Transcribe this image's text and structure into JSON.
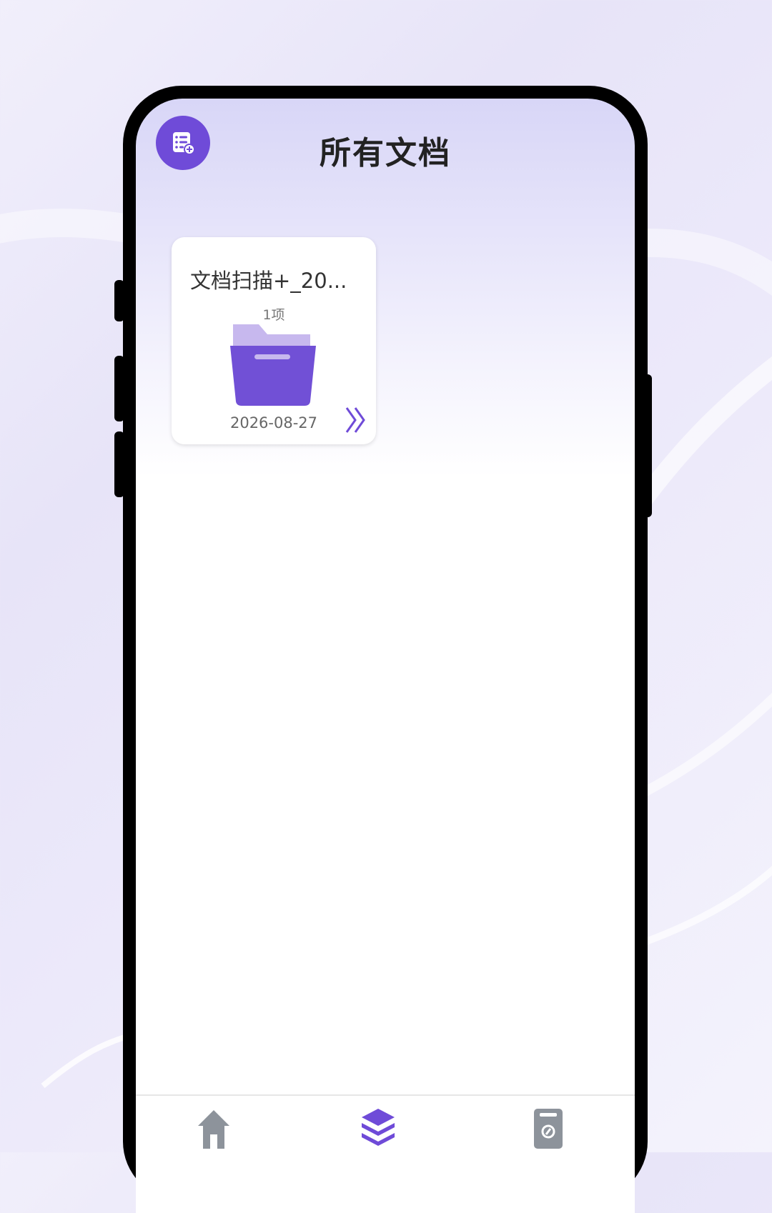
{
  "header": {
    "title": "所有文档",
    "add_icon": "document-list-add-icon"
  },
  "folders": [
    {
      "name": "文档扫描+_20...",
      "count": "1项",
      "date": "2026-08-27",
      "icon": "folder-icon",
      "open_icon": "double-chevron-right-icon"
    }
  ],
  "bottom_nav": {
    "items": [
      {
        "icon": "home-icon",
        "active": false
      },
      {
        "icon": "layers-icon",
        "active": true
      },
      {
        "icon": "file-settings-icon",
        "active": false
      }
    ]
  },
  "colors": {
    "accent": "#6f4bd8",
    "folder_back": "#c7b8ee",
    "folder_front": "#7150d6",
    "nav_inactive": "#8d939b"
  }
}
